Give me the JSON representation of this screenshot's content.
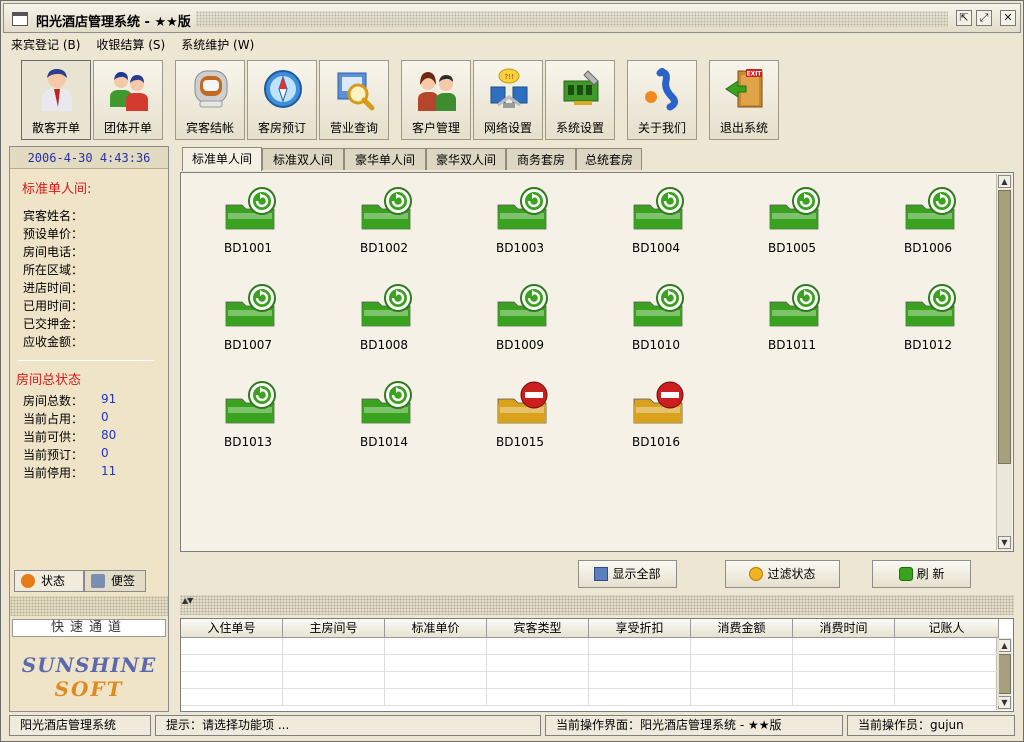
{
  "window": {
    "title": "阳光酒店管理系统 - ★★版",
    "buttons": [
      "restore",
      "maximize",
      "close"
    ]
  },
  "menu": [
    "来宾登记 (B)",
    "收银结算 (S)",
    "系统维护 (W)"
  ],
  "toolbar": [
    {
      "label": "散客开单",
      "icon": "guest-icon"
    },
    {
      "label": "团体开单",
      "icon": "group-icon"
    },
    {
      "label": "宾客结帐",
      "icon": "checkout-icon"
    },
    {
      "label": "客房预订",
      "icon": "compass-icon"
    },
    {
      "label": "营业查询",
      "icon": "search-icon"
    },
    {
      "label": "客户管理",
      "icon": "customer-icon"
    },
    {
      "label": "网络设置",
      "icon": "network-icon"
    },
    {
      "label": "系统设置",
      "icon": "settings-icon"
    },
    {
      "label": "关于我们",
      "icon": "about-icon"
    },
    {
      "label": "退出系统",
      "icon": "exit-icon",
      "badge": "EXIT"
    }
  ],
  "left_panel": {
    "clock": "2006-4-30 4:43:36",
    "room_title": "标准单人间:",
    "fields": [
      "宾客姓名：",
      "预设单价：",
      "房间电话：",
      "所在区域：",
      "进店时间：",
      "已用时间：",
      "已交押金：",
      "应收金额："
    ],
    "status_title": "房间总状态",
    "stats": [
      {
        "label": "房间总数：",
        "value": "91"
      },
      {
        "label": "当前占用：",
        "value": "0"
      },
      {
        "label": "当前可供：",
        "value": "80"
      },
      {
        "label": "当前预订：",
        "value": "0"
      },
      {
        "label": "当前停用：",
        "value": "11"
      }
    ],
    "tabs": [
      "状态",
      "便签"
    ],
    "quick_channel": "快速通道",
    "brand_line1": "SUNSHINE",
    "brand_line2": "SOFT"
  },
  "room_tabs": [
    "标准单人间",
    "标准双人间",
    "豪华单人间",
    "豪华双人间",
    "商务套房",
    "总统套房"
  ],
  "active_room_tab": 0,
  "rooms": [
    {
      "id": "BD1001",
      "status": "available"
    },
    {
      "id": "BD1002",
      "status": "available"
    },
    {
      "id": "BD1003",
      "status": "available"
    },
    {
      "id": "BD1004",
      "status": "available"
    },
    {
      "id": "BD1005",
      "status": "available"
    },
    {
      "id": "BD1006",
      "status": "available"
    },
    {
      "id": "BD1007",
      "status": "available"
    },
    {
      "id": "BD1008",
      "status": "available"
    },
    {
      "id": "BD1009",
      "status": "available"
    },
    {
      "id": "BD1010",
      "status": "available"
    },
    {
      "id": "BD1011",
      "status": "available"
    },
    {
      "id": "BD1012",
      "status": "available"
    },
    {
      "id": "BD1013",
      "status": "available"
    },
    {
      "id": "BD1014",
      "status": "available"
    },
    {
      "id": "BD1015",
      "status": "disabled"
    },
    {
      "id": "BD1016",
      "status": "disabled"
    }
  ],
  "actions": {
    "show_all": "显示全部",
    "filter_status": "过滤状态",
    "refresh": "刷 新"
  },
  "table": {
    "columns": [
      "入住单号",
      "主房间号",
      "标准单价",
      "宾客类型",
      "享受折扣",
      "消费金额",
      "消费时间",
      "记账人"
    ],
    "rows": []
  },
  "statusbar": {
    "app": "阳光酒店管理系统",
    "hint": "提示：请选择功能项 ...",
    "interface": "当前操作界面：阳光酒店管理系统 - ★★版",
    "operator": "当前操作员：gujun"
  },
  "colors": {
    "available": "#3aa21f",
    "disabled": "#d8a21c",
    "stop_sign": "#cc1e1e",
    "accent_red": "#d41a1a",
    "value_blue": "#2233bb"
  }
}
